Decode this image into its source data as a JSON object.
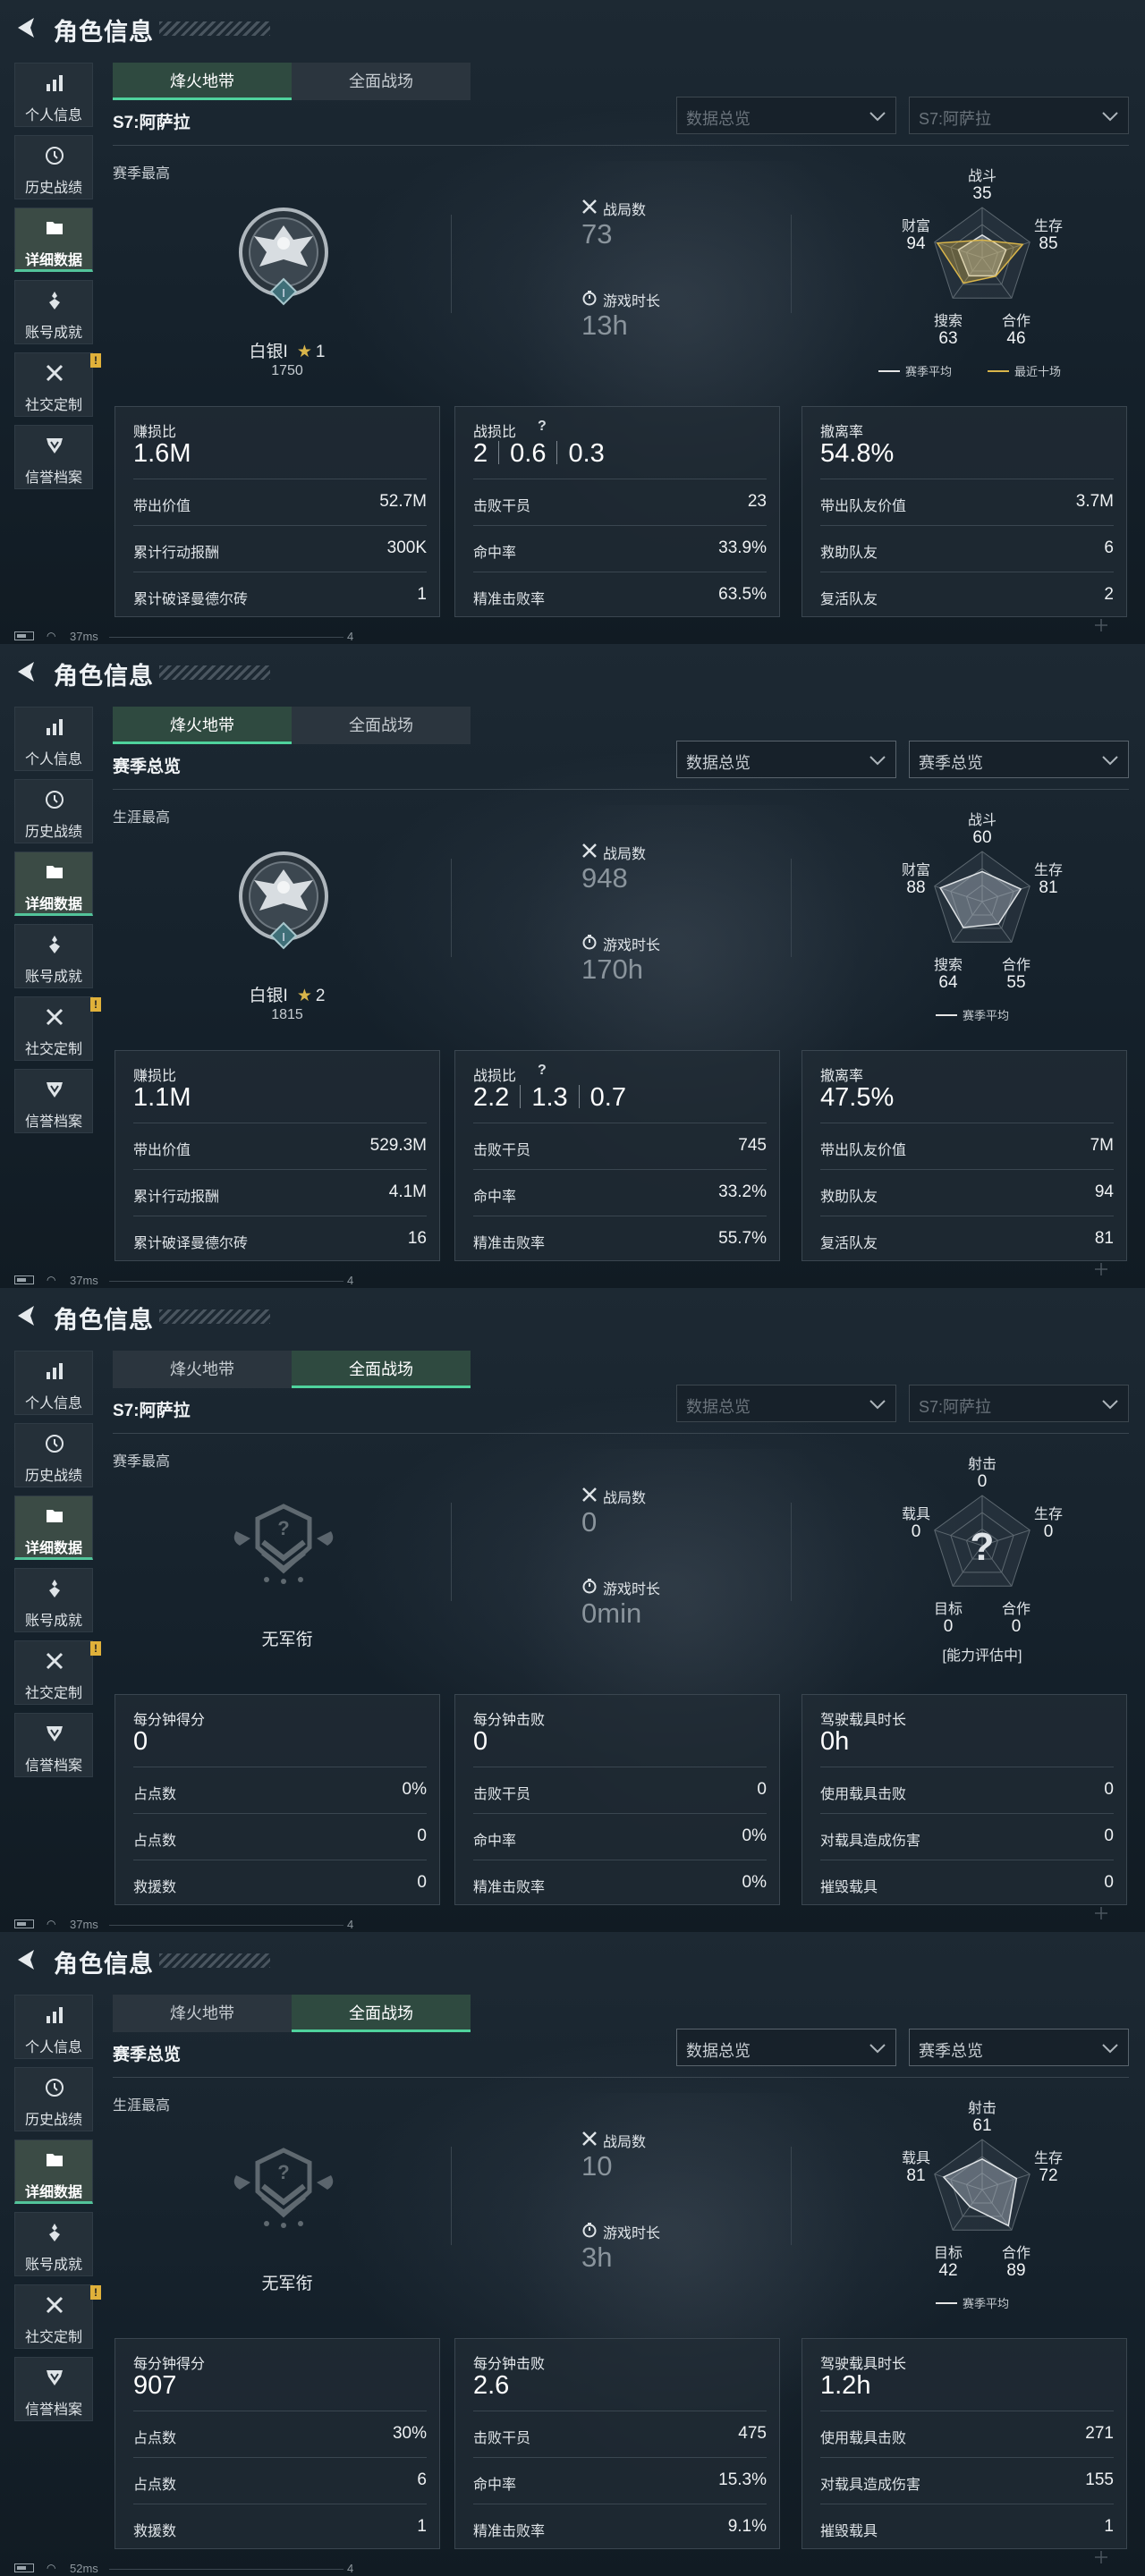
{
  "common": {
    "title": "角色信息",
    "sidebar": [
      "个人信息",
      "历史战绩",
      "详细数据",
      "账号成就",
      "社交定制",
      "信誉档案"
    ],
    "sidebar_badge": "!",
    "tabs": [
      "烽火地带",
      "全面战场"
    ],
    "dropdown_left": "数据总览",
    "battles_label": "战局数",
    "time_label": "游戏时长",
    "help_mark": "?",
    "accent": "#4fd39c"
  },
  "p1": {
    "active_tab": 0,
    "season": "S7:阿萨拉",
    "dd2": "S7:阿萨拉",
    "dd_disabled": true,
    "sub": "赛季最高",
    "rank": "白银I",
    "stars": "1",
    "points": "1750",
    "battles": "73",
    "time": "13h",
    "radar": {
      "labels": [
        "战斗",
        "生存",
        "合作",
        "搜索",
        "财富"
      ],
      "values": [
        "35",
        "85",
        "46",
        "63",
        "94"
      ],
      "avg": [
        0.45,
        0.5,
        0.45,
        0.45,
        0.5
      ],
      "recent": [
        0.35,
        0.85,
        0.46,
        0.63,
        0.94
      ],
      "legend": [
        "赛季平均",
        "最近十场"
      ],
      "legend_colors": [
        "#e6e6e6",
        "#d9b54a"
      ]
    },
    "card1": {
      "label": "赚损比",
      "value": "1.6M",
      "rows": [
        [
          "带出价值",
          "52.7M"
        ],
        [
          "累计行动报酬",
          "300K"
        ],
        [
          "累计破译曼德尔砖",
          "1"
        ]
      ]
    },
    "card2": {
      "label": "战损比",
      "kd": [
        "2",
        "0.6",
        "0.3"
      ],
      "rows": [
        [
          "击败干员",
          "23"
        ],
        [
          "命中率",
          "33.9%"
        ],
        [
          "精准击败率",
          "63.5%"
        ]
      ]
    },
    "card3": {
      "label": "撤离率",
      "value": "54.8%",
      "rows": [
        [
          "带出队友价值",
          "3.7M"
        ],
        [
          "救助队友",
          "6"
        ],
        [
          "复活队友",
          "2"
        ]
      ]
    },
    "status_ms": "37ms",
    "status_num": "4"
  },
  "p2": {
    "active_tab": 0,
    "season": "赛季总览",
    "dd2": "赛季总览",
    "dd_disabled": false,
    "sub": "生涯最高",
    "rank": "白银I",
    "stars": "2",
    "points": "1815",
    "battles": "948",
    "time": "170h",
    "radar": {
      "labels": [
        "战斗",
        "生存",
        "合作",
        "搜索",
        "财富"
      ],
      "values": [
        "60",
        "81",
        "55",
        "64",
        "88"
      ],
      "avg": [
        0.6,
        0.81,
        0.55,
        0.64,
        0.88
      ],
      "legend": [
        "赛季平均"
      ]
    },
    "card1": {
      "label": "赚损比",
      "value": "1.1M",
      "rows": [
        [
          "带出价值",
          "529.3M"
        ],
        [
          "累计行动报酬",
          "4.1M"
        ],
        [
          "累计破译曼德尔砖",
          "16"
        ]
      ]
    },
    "card2": {
      "label": "战损比",
      "kd": [
        "2.2",
        "1.3",
        "0.7"
      ],
      "rows": [
        [
          "击败干员",
          "745"
        ],
        [
          "命中率",
          "33.2%"
        ],
        [
          "精准击败率",
          "55.7%"
        ]
      ]
    },
    "card3": {
      "label": "撤离率",
      "value": "47.5%",
      "rows": [
        [
          "带出队友价值",
          "7M"
        ],
        [
          "救助队友",
          "94"
        ],
        [
          "复活队友",
          "81"
        ]
      ]
    },
    "status_ms": "37ms",
    "status_num": "4"
  },
  "p3": {
    "active_tab": 1,
    "season": "S7:阿萨拉",
    "dd2": "S7:阿萨拉",
    "dd_disabled": true,
    "sub": "赛季最高",
    "rank": "无军衔",
    "battles": "0",
    "time": "0min",
    "radar": {
      "labels": [
        "射击",
        "生存",
        "合作",
        "目标",
        "载具"
      ],
      "values": [
        "0",
        "0",
        "0",
        "0",
        "0"
      ],
      "unknown": "?",
      "note": "[能力评估中]"
    },
    "card1": {
      "label": "每分钟得分",
      "value": "0",
      "rows": [
        [
          "占点数",
          "0%"
        ],
        [
          "占点数",
          "0"
        ],
        [
          "救援数",
          "0"
        ]
      ]
    },
    "card2": {
      "label": "每分钟击败",
      "value": "0",
      "rows": [
        [
          "击败干员",
          "0"
        ],
        [
          "命中率",
          "0%"
        ],
        [
          "精准击败率",
          "0%"
        ]
      ]
    },
    "card3": {
      "label": "驾驶载具时长",
      "value": "0h",
      "rows": [
        [
          "使用载具击败",
          "0"
        ],
        [
          "对载具造成伤害",
          "0"
        ],
        [
          "摧毁载具",
          "0"
        ]
      ]
    },
    "status_ms": "37ms",
    "status_num": "4"
  },
  "p4": {
    "active_tab": 1,
    "season": "赛季总览",
    "dd2": "赛季总览",
    "dd_disabled": false,
    "sub": "生涯最高",
    "rank": "无军衔",
    "battles": "10",
    "time": "3h",
    "radar": {
      "labels": [
        "射击",
        "生存",
        "合作",
        "目标",
        "载具"
      ],
      "values": [
        "61",
        "72",
        "89",
        "42",
        "81"
      ],
      "avg": [
        0.61,
        0.72,
        0.89,
        0.42,
        0.81
      ],
      "legend": [
        "赛季平均"
      ]
    },
    "card1": {
      "label": "每分钟得分",
      "value": "907",
      "rows": [
        [
          "占点数",
          "30%"
        ],
        [
          "占点数",
          "6"
        ],
        [
          "救援数",
          "1"
        ]
      ]
    },
    "card2": {
      "label": "每分钟击败",
      "value": "2.6",
      "rows": [
        [
          "击败干员",
          "475"
        ],
        [
          "命中率",
          "15.3%"
        ],
        [
          "精准击败率",
          "9.1%"
        ]
      ]
    },
    "card3": {
      "label": "驾驶载具时长",
      "value": "1.2h",
      "rows": [
        [
          "使用载具击败",
          "271"
        ],
        [
          "对载具造成伤害",
          "155"
        ],
        [
          "摧毁载具",
          "1"
        ]
      ]
    },
    "status_ms": "52ms",
    "status_num": "4"
  }
}
